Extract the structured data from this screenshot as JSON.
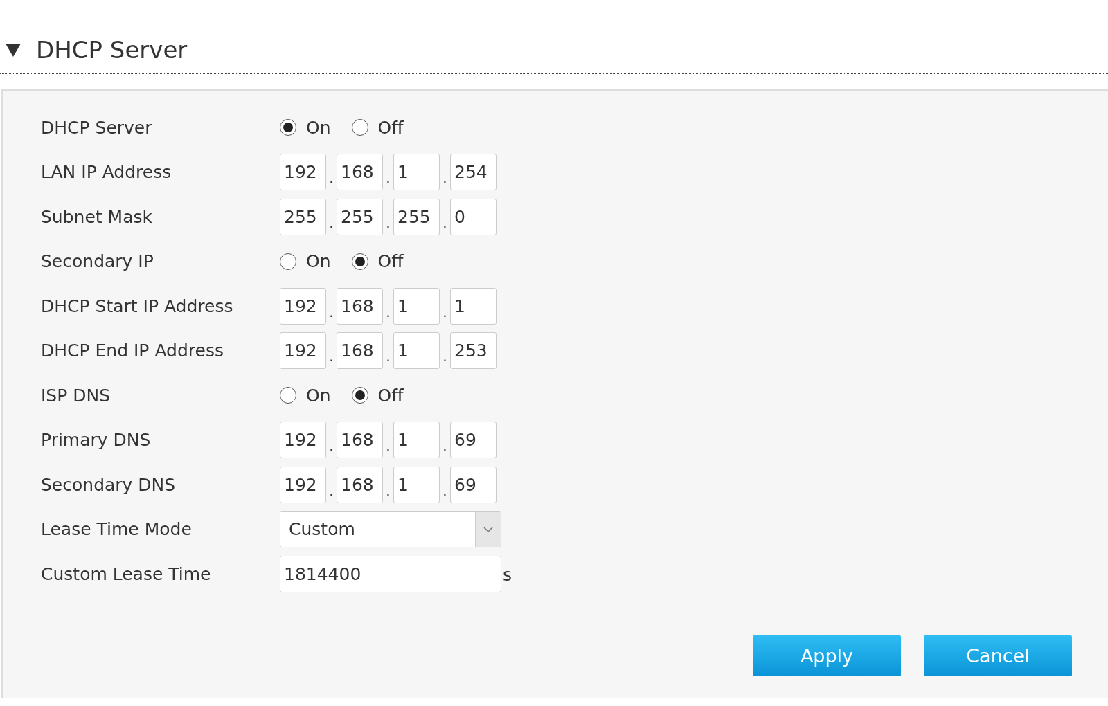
{
  "section": {
    "title": "DHCP Server",
    "expanded": true
  },
  "rows": [
    {
      "kind": "radio",
      "label": "DHCP Server",
      "options": [
        {
          "label": "On",
          "selected": true
        },
        {
          "label": "Off",
          "selected": false
        }
      ]
    },
    {
      "kind": "ip",
      "label": "LAN IP Address",
      "octets": [
        "192",
        "168",
        "1",
        "254"
      ],
      "separators": [
        ".",
        ".",
        "."
      ]
    },
    {
      "kind": "ip",
      "label": "Subnet Mask",
      "octets": [
        "255",
        "255",
        "255",
        "0"
      ],
      "separators": [
        ".",
        ".",
        "."
      ]
    },
    {
      "kind": "radio",
      "label": "Secondary IP",
      "options": [
        {
          "label": "On",
          "selected": false
        },
        {
          "label": "Off",
          "selected": true
        }
      ]
    },
    {
      "kind": "ip",
      "label": "DHCP Start IP Address",
      "octets": [
        "192",
        "168",
        "1",
        "1"
      ],
      "separators": [
        ".",
        ".",
        "."
      ]
    },
    {
      "kind": "ip",
      "label": "DHCP End IP Address",
      "octets": [
        "192",
        "168",
        "1",
        "253"
      ],
      "separators": [
        ".",
        ".",
        "."
      ]
    },
    {
      "kind": "radio",
      "label": "ISP DNS",
      "options": [
        {
          "label": "On",
          "selected": false
        },
        {
          "label": "Off",
          "selected": true
        }
      ]
    },
    {
      "kind": "ip",
      "label": "Primary DNS",
      "octets": [
        "192",
        "168",
        "1",
        "69"
      ],
      "separators": [
        ".",
        ".",
        "."
      ]
    },
    {
      "kind": "ip",
      "label": "Secondary DNS",
      "octets": [
        "192",
        "168",
        "1",
        "69"
      ],
      "separators": [
        ".",
        ".",
        "."
      ]
    },
    {
      "kind": "select",
      "label": "Lease Time Mode",
      "value": "Custom"
    },
    {
      "kind": "text",
      "label": "Custom Lease Time",
      "value": "1814400",
      "unit": "s"
    }
  ],
  "buttons": [
    "Apply",
    "Cancel"
  ]
}
